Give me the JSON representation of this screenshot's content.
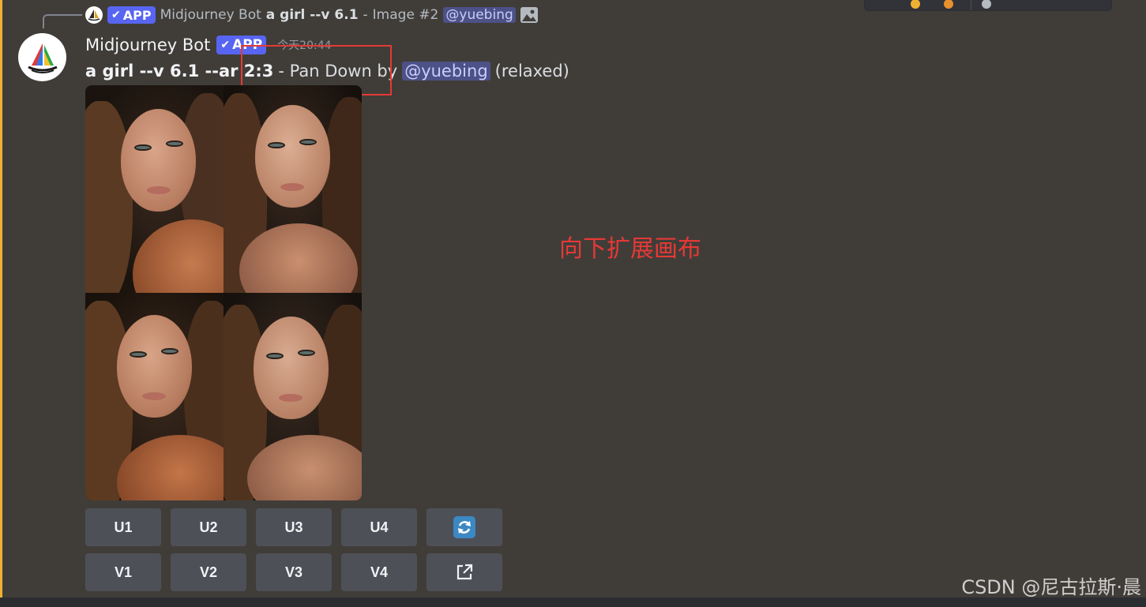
{
  "reply": {
    "app_badge": "APP",
    "bot_name": "Midjourney Bot",
    "prompt": "a girl --v 6.1",
    "dash": "-",
    "image_label": "Image #2",
    "mention": "@yuebing"
  },
  "message": {
    "username": "Midjourney Bot",
    "app_badge": "APP",
    "timestamp": "今天20:44",
    "prompt": "a girl --v 6.1 --ar 2:3",
    "action_text": "- Pan Down by",
    "mention": "@yuebing",
    "mode": "(relaxed)"
  },
  "buttons": {
    "row1": [
      "U1",
      "U2",
      "U3",
      "U4"
    ],
    "row2": [
      "V1",
      "V2",
      "V3",
      "V4"
    ],
    "reroll_icon": "refresh-icon",
    "open_icon": "external-link-icon"
  },
  "annotation": "向下扩展画布",
  "watermark": "CSDN @尼古拉斯·晨",
  "colors": {
    "accent_bar": "#f0b132",
    "app_badge": "#5865f2",
    "mention_bg": "#4c5187",
    "annotation": "#e53935",
    "button_bg": "#4e5058",
    "background": "#403d39"
  }
}
